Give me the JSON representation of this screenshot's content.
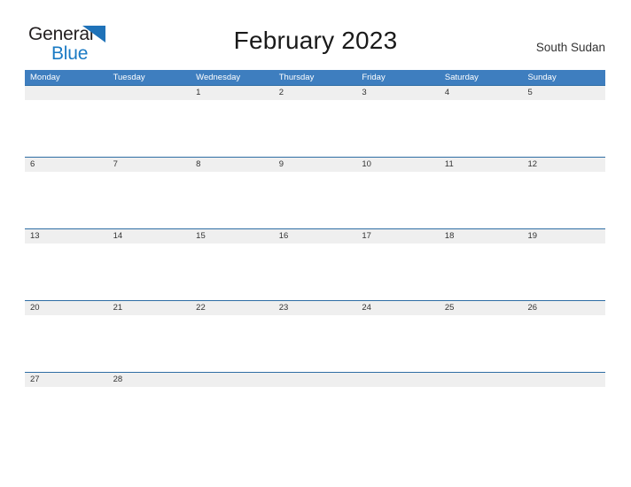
{
  "logo": {
    "text_top": "General",
    "text_bottom": "Blue",
    "flag_icon": "blue-flag-triangle-icon",
    "color_dark": "#231f20",
    "color_blue": "#1a7ac4"
  },
  "header": {
    "title": "February 2023",
    "region": "South Sudan"
  },
  "theme": {
    "header_blue": "#3e7ebf",
    "row_rule_blue": "#2e6da4",
    "band_gray": "#efefef",
    "text_dark": "#333333",
    "page_background": "#ffffff"
  },
  "calendar": {
    "weekdays": [
      "Monday",
      "Tuesday",
      "Wednesday",
      "Thursday",
      "Friday",
      "Saturday",
      "Sunday"
    ],
    "weeks": [
      [
        "",
        "",
        "1",
        "2",
        "3",
        "4",
        "5"
      ],
      [
        "6",
        "7",
        "8",
        "9",
        "10",
        "11",
        "12"
      ],
      [
        "13",
        "14",
        "15",
        "16",
        "17",
        "18",
        "19"
      ],
      [
        "20",
        "21",
        "22",
        "23",
        "24",
        "25",
        "26"
      ],
      [
        "27",
        "28",
        "",
        "",
        "",
        "",
        ""
      ]
    ]
  }
}
